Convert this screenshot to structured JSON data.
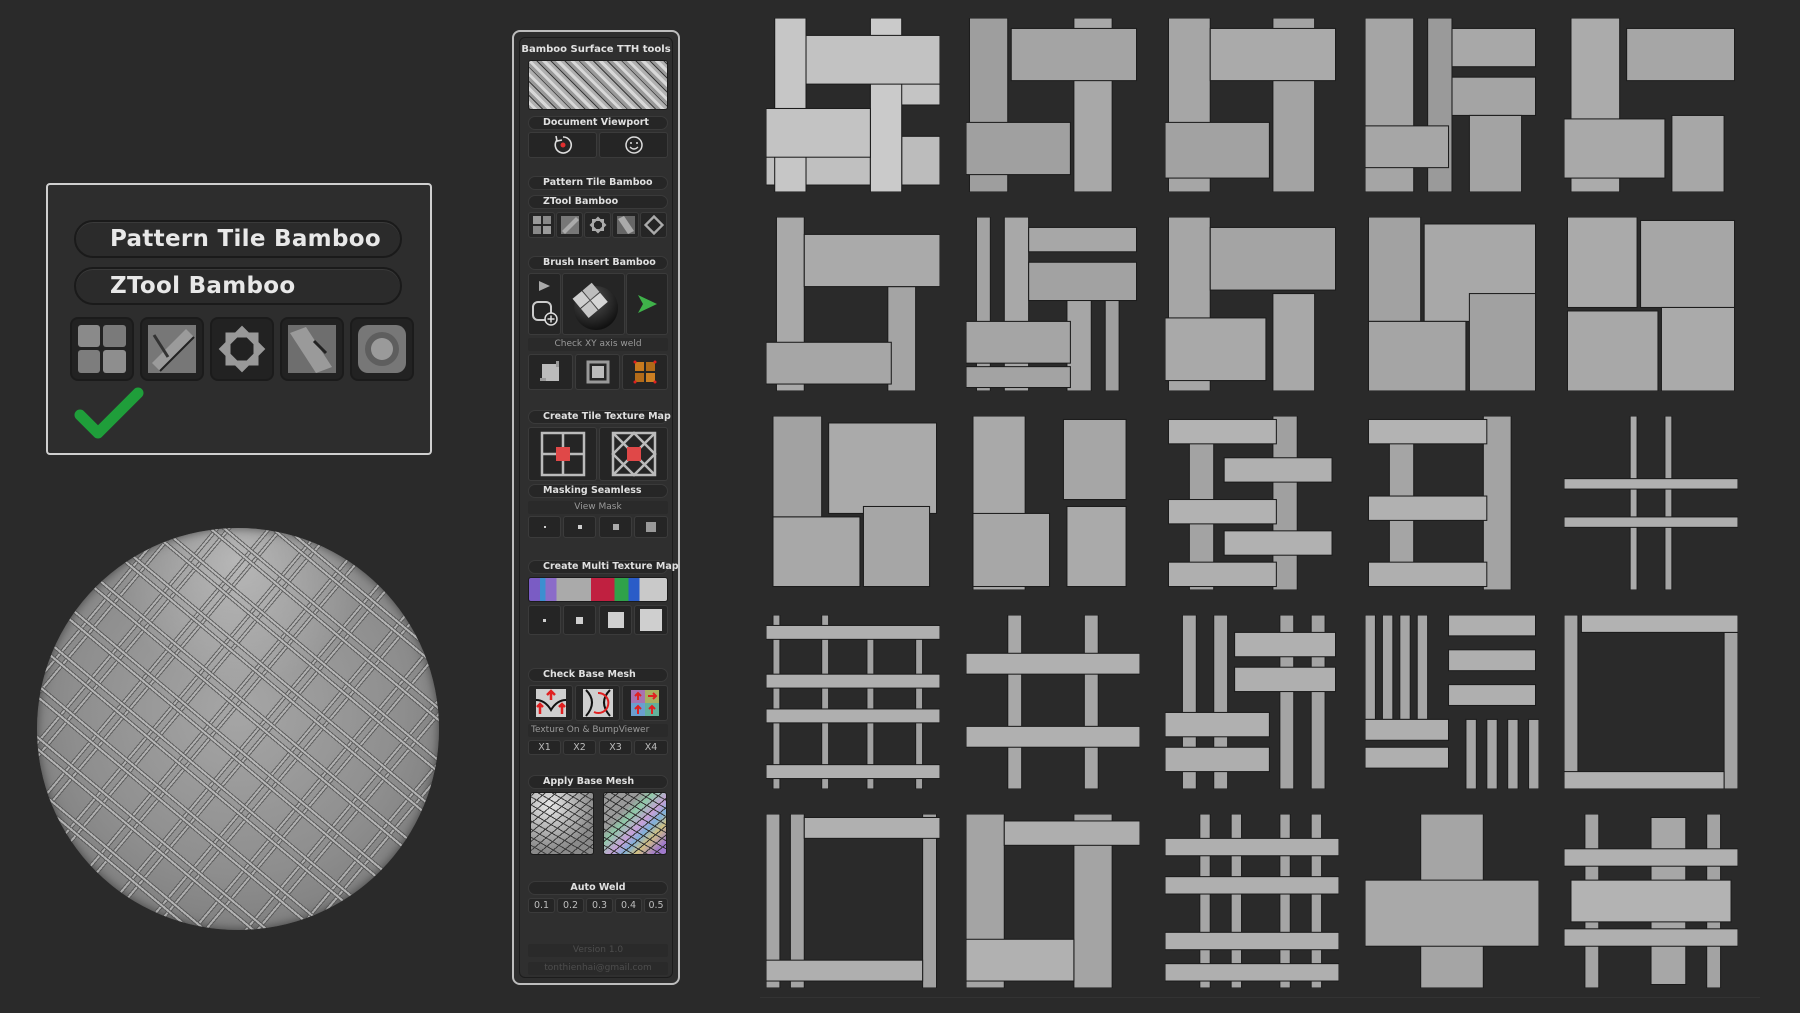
{
  "preview": {
    "pattern_tile_label": "Pattern Tile Bamboo",
    "ztool_label": "ZTool Bamboo",
    "ztool_icons": [
      "block-tile-icon",
      "diagonal-tile-icon",
      "star-tile-icon",
      "slant-tile-icon",
      "ring-tile-icon"
    ],
    "status_icon": "green-check-icon",
    "check_color": "#1f9e3a"
  },
  "panel": {
    "title": "Bamboo Surface TTH tools",
    "document_viewport": {
      "label": "Document Viewport",
      "buttons": [
        "reset-rotation-icon",
        "smiley-face-icon"
      ]
    },
    "pattern_tile_label": "Pattern Tile Bamboo",
    "ztool_label": "ZTool Bamboo",
    "ztool_icons": [
      "block-tile-icon",
      "diagonal-tile-icon",
      "star-tile-icon",
      "slant-tile-icon",
      "ring-tile-icon"
    ],
    "brush_insert": {
      "label": "Brush Insert Bamboo",
      "axis_weld_label": "Check XY axis weld",
      "play_color": "#3fb24a"
    },
    "tile_texture": {
      "label": "Create Tile Texture Map",
      "masking_label": "Masking Seamless",
      "view_mask_label": "View Mask",
      "view_mask_sizes": [
        "xs",
        "s",
        "m",
        "l"
      ],
      "mask_color": "#e04848"
    },
    "multi_texture": {
      "label": "Create Multi Texture Map",
      "sizes": [
        "xs",
        "s",
        "m",
        "l"
      ]
    },
    "base_mesh": {
      "label": "Check Base Mesh",
      "texture_label": "Texture On & BumpViewer",
      "multipliers": [
        "X1",
        "X2",
        "X3",
        "X4"
      ]
    },
    "apply_mesh": {
      "label": "Apply Base Mesh"
    },
    "auto_weld": {
      "label": "Auto Weld",
      "values": [
        "0.1",
        "0.2",
        "0.3",
        "0.4",
        "0.5"
      ]
    },
    "version": "Version 1.0",
    "email": "tonthienhai@gmail.com"
  },
  "tiles": {
    "rows": 5,
    "cols": 5,
    "count": 25,
    "names": [
      "basket-2x2-wide",
      "basket-2x2-ribbed",
      "basket-2x2-grooved",
      "basket-2x3-mixed",
      "basket-2x2-round",
      "basket-offset",
      "basket-double-strand",
      "basket-grooved-offset",
      "parquet-ribbed",
      "parquet-block",
      "parquet-striped",
      "parquet-plain",
      "weave-wavy",
      "weave-wavy-wide",
      "cross-thin",
      "lattice-rods",
      "cross-double",
      "weave-checker",
      "parquet-dense",
      "frame-square",
      "frame-double",
      "frame-ribbed",
      "lattice-thin",
      "cross-wide",
      "cross-mixed"
    ]
  }
}
